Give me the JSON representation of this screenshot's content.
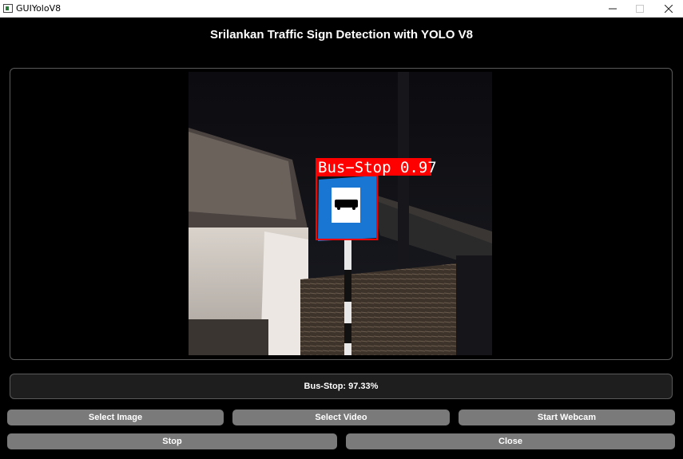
{
  "window": {
    "title": "GUIYoloV8"
  },
  "header": {
    "title": "Srilankan Traffic Sign Detection with YOLO V8"
  },
  "detection": {
    "box_label": "Bus−Stop 0.97",
    "color": "#ff0000"
  },
  "result": {
    "text": "Bus-Stop: 97.33%"
  },
  "buttons": {
    "select_image": "Select Image",
    "select_video": "Select Video",
    "start_webcam": "Start Webcam",
    "stop": "Stop",
    "close": "Close"
  },
  "colors": {
    "background": "#000000",
    "button": "#7a7a7a",
    "sign": "#1976d2"
  }
}
